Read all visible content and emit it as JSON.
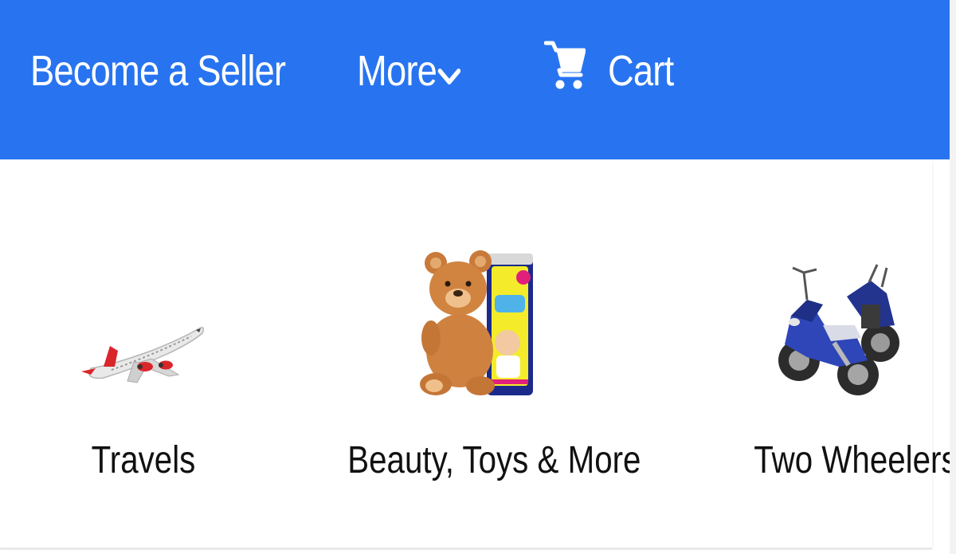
{
  "header": {
    "background_color": "#2874f0",
    "text_color": "#ffffff",
    "become_seller_label": "Become a Seller",
    "more_label": "More",
    "more_icon": "chevron-down-icon",
    "cart_label": "Cart",
    "cart_icon": "shopping-cart-icon"
  },
  "categories": [
    {
      "label": "Travels",
      "image": "airplane-image"
    },
    {
      "label": "Beauty, Toys & More",
      "image": "teddy-bear-and-diapers-image"
    },
    {
      "label": "Two Wheelers",
      "image": "motorcycles-image"
    }
  ]
}
